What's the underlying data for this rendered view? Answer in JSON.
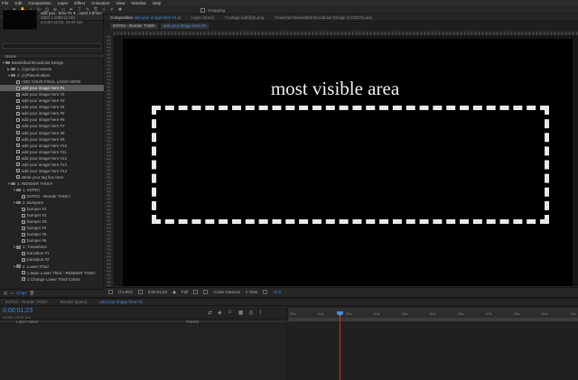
{
  "menu": [
    "File",
    "Edit",
    "Composition",
    "Layer",
    "Effect",
    "Animation",
    "View",
    "Window",
    "Help"
  ],
  "toolbar": {
    "snapping_label": "Snapping"
  },
  "project": {
    "tab_label": "Project",
    "thumb_name": "add you...here #1 ▾ , used 3 times",
    "thumb_info1": "1920 x 1080 (1.00)",
    "thumb_info2": "Δ 0;00;10;00, 29.97 fps",
    "column_header": "Name",
    "items": [
      {
        "label": "Basketball Broadcast Design",
        "kind": "folder",
        "indent": 0,
        "open": true
      },
      {
        "label": "1. (1)project assets",
        "kind": "folder",
        "indent": 1,
        "open": false
      },
      {
        "label": "2. (1)Placeholders",
        "kind": "folder",
        "indent": 1,
        "open": true
      },
      {
        "label": "ADD YOUR FINAL LOGO HERE",
        "kind": "comp",
        "indent": 2
      },
      {
        "label": "add your image here #1",
        "kind": "comp",
        "indent": 2,
        "selected": true
      },
      {
        "label": "add your image here #2",
        "kind": "comp",
        "indent": 2
      },
      {
        "label": "add your image here #3",
        "kind": "comp",
        "indent": 2
      },
      {
        "label": "add your image here #4",
        "kind": "comp",
        "indent": 2
      },
      {
        "label": "add your image here #5",
        "kind": "comp",
        "indent": 2
      },
      {
        "label": "add your image here #6",
        "kind": "comp",
        "indent": 2
      },
      {
        "label": "add your image here #7",
        "kind": "comp",
        "indent": 2
      },
      {
        "label": "add your image here #8",
        "kind": "comp",
        "indent": 2
      },
      {
        "label": "add your image here #9",
        "kind": "comp",
        "indent": 2
      },
      {
        "label": "add your image here #10",
        "kind": "comp",
        "indent": 2
      },
      {
        "label": "add your image here #11",
        "kind": "comp",
        "indent": 2
      },
      {
        "label": "add your image here #12",
        "kind": "comp",
        "indent": 2
      },
      {
        "label": "add your image here #13",
        "kind": "comp",
        "indent": 2
      },
      {
        "label": "add your image here #14",
        "kind": "comp",
        "indent": 2
      },
      {
        "label": "Write your tag line here",
        "kind": "comp",
        "indent": 2
      },
      {
        "label": "3. RENDER THIS!!!",
        "kind": "folder",
        "indent": 1,
        "open": true
      },
      {
        "label": "1. INTRO",
        "kind": "folder",
        "indent": 2,
        "open": true
      },
      {
        "label": "INTRO - Render THIS!!!",
        "kind": "comp",
        "indent": 3
      },
      {
        "label": "2. Bumpers",
        "kind": "folder",
        "indent": 2,
        "open": true
      },
      {
        "label": "bumper #1",
        "kind": "comp",
        "indent": 3
      },
      {
        "label": "bumper #2",
        "kind": "comp",
        "indent": 3
      },
      {
        "label": "bumper #3",
        "kind": "comp",
        "indent": 3
      },
      {
        "label": "bumper #4",
        "kind": "comp",
        "indent": 3
      },
      {
        "label": "bumper #5",
        "kind": "comp",
        "indent": 3
      },
      {
        "label": "bumper #6",
        "kind": "comp",
        "indent": 3
      },
      {
        "label": "3. Transitions",
        "kind": "folder",
        "indent": 2,
        "open": true
      },
      {
        "label": "transition #1",
        "kind": "comp",
        "indent": 3
      },
      {
        "label": "transition #2",
        "kind": "comp",
        "indent": 3
      },
      {
        "label": "4. Lower Third",
        "kind": "folder",
        "indent": 2,
        "open": true
      },
      {
        "label": "1.Main Lower Third --RENDER THIS!!",
        "kind": "comp",
        "indent": 3
      },
      {
        "label": "2.Change Lower Third Colors",
        "kind": "comp",
        "indent": 3
      }
    ],
    "footer_bpc": "8 bpc"
  },
  "comp_tabs": [
    {
      "prefix": "Composition ",
      "name": "add your image here #1",
      "suffix": " ≡",
      "active": true
    },
    {
      "prefix": "Layer ",
      "name": "(none)",
      "suffix": "",
      "active": false
    },
    {
      "prefix": "Footage ",
      "name": "ball@pp.png",
      "suffix": "",
      "active": false
    },
    {
      "prefix": "Flowchart ",
      "name": "Basketball Broadcast Design (CC2015).aep",
      "suffix": "",
      "active": false
    }
  ],
  "comp_subtabs": [
    {
      "label": "INTRO - Render THIS!!",
      "hl": false
    },
    {
      "label": "add your image here #1",
      "hl": true
    }
  ],
  "canvas": {
    "headline": "most visible area"
  },
  "viewer_footer": {
    "zoom": "(71.8%)",
    "timecode": "0;00;01;23",
    "resolution": "Full",
    "camera": "Active Camera",
    "views": "1 View",
    "exposure": "+0.0"
  },
  "timeline": {
    "tabs": [
      {
        "label": "INTRO - Render THIS!!",
        "active": false
      },
      {
        "label": "Render Queue",
        "active": false
      },
      {
        "label": "add your image here #1",
        "active": true
      }
    ],
    "timecode": "0;00;01;23",
    "timecode_sub": "00053 (29.97 fps)",
    "col_layer_name": "Layer Name",
    "col_parent": "Parent",
    "ruler_ticks": [
      "00s",
      "01s",
      "02s",
      "03s",
      "04s",
      "05s",
      "06s",
      "07s",
      "08s",
      "09s",
      "10s"
    ],
    "playhead_seconds": 1.77,
    "duration_seconds": 10
  },
  "colors": {
    "accent": "#3f8ede",
    "playhead": "#c23b2b",
    "canvas": "#000000"
  }
}
